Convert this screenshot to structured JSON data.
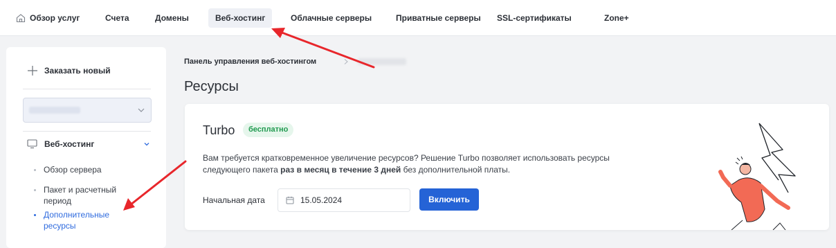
{
  "topnav": {
    "items": [
      {
        "label": "Обзор услуг"
      },
      {
        "label": "Счета"
      },
      {
        "label": "Домены"
      },
      {
        "label": "Веб-хостинг"
      },
      {
        "label": "Облачные серверы"
      },
      {
        "label": "Приватные серверы"
      },
      {
        "label": "SSL-сертификаты"
      },
      {
        "label": "Zone+"
      }
    ],
    "active_index": 3
  },
  "sidebar": {
    "order_label": "Заказать новый",
    "section_label": "Веб-хостинг",
    "sub_items": [
      {
        "label": "Обзор сервера"
      },
      {
        "label": "Пакет и расчетный период"
      },
      {
        "label": "Дополнительные ресурсы"
      }
    ],
    "active_sub_index": 2
  },
  "breadcrumb": {
    "root": "Панель управления веб-хостингом"
  },
  "page_title": "Ресурсы",
  "turbo_card": {
    "title": "Turbo",
    "badge": "бесплатно",
    "desc_line1": "Вам требуется кратковременное увеличение ресурсов? Решение Turbo позволяет использовать ресурсы",
    "desc_line2_pre": "следующего пакета ",
    "desc_line2_bold": "раз в месяц в течение 3 дней",
    "desc_line2_post": " без дополнительной платы.",
    "date_label": "Начальная дата",
    "date_value": "15.05.2024",
    "enable_label": "Включить"
  },
  "colors": {
    "accent": "#2563d6",
    "active_link": "#2f6bde",
    "badge_bg": "#e6f6ec",
    "badge_text": "#1f9a4f",
    "annotation_arrow": "#e8262b",
    "illustration_figure": "#f26a55"
  },
  "icons": [
    "home-icon",
    "plus-icon",
    "chevron-down-icon",
    "monitor-icon",
    "chevron-right-icon",
    "calendar-icon"
  ]
}
